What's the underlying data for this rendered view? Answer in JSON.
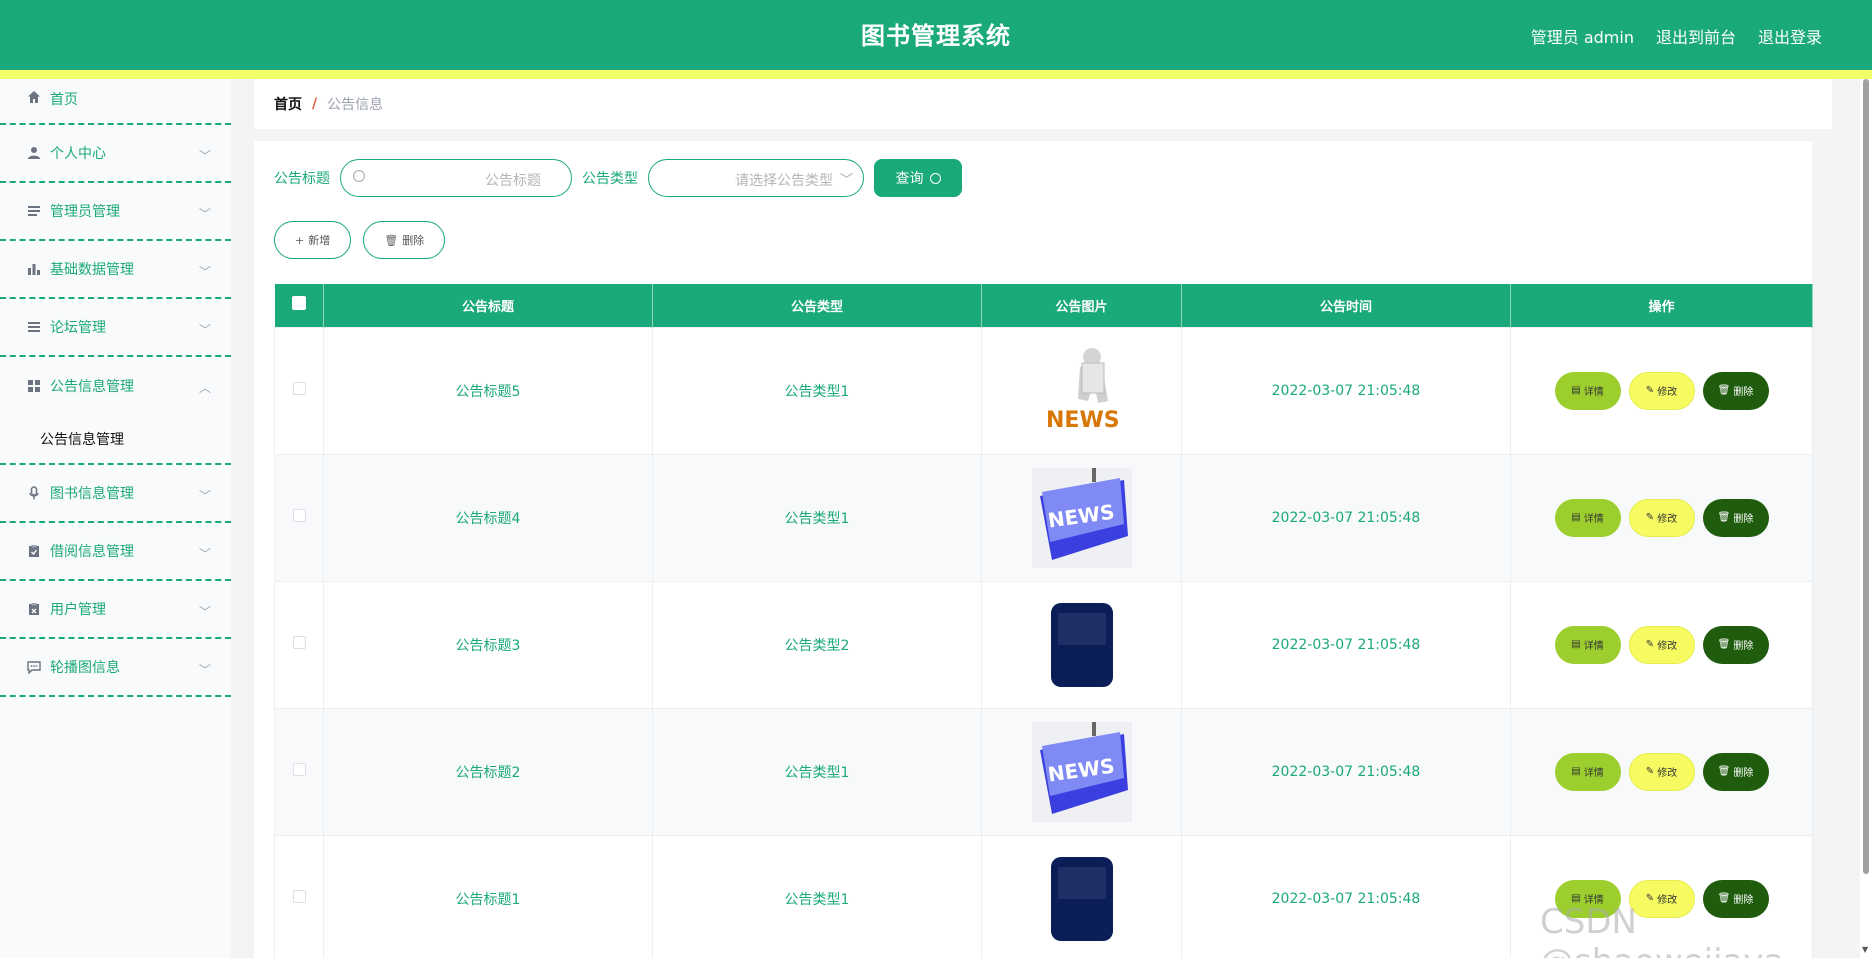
{
  "header": {
    "title": "图书管理系统",
    "admin_label": "管理员 admin",
    "to_front_label": "退出到前台",
    "logout_label": "退出登录"
  },
  "sidebar": {
    "items": [
      {
        "label": "首页",
        "icon": "home-icon"
      },
      {
        "label": "个人中心",
        "icon": "user-icon"
      },
      {
        "label": "管理员管理",
        "icon": "list-icon"
      },
      {
        "label": "基础数据管理",
        "icon": "bar-chart-icon"
      },
      {
        "label": "论坛管理",
        "icon": "menu-icon"
      },
      {
        "label": "公告信息管理",
        "icon": "grid-icon",
        "expanded": true,
        "sub": [
          "公告信息管理"
        ]
      },
      {
        "label": "图书信息管理",
        "icon": "microphone-icon"
      },
      {
        "label": "借阅信息管理",
        "icon": "clipboard-check-icon"
      },
      {
        "label": "用户管理",
        "icon": "clipboard-icon"
      },
      {
        "label": "轮播图信息",
        "icon": "chat-icon"
      }
    ]
  },
  "breadcrumb": {
    "home": "首页",
    "separator": "/",
    "current": "公告信息"
  },
  "search": {
    "title_label": "公告标题",
    "title_placeholder": "公告标题",
    "type_label": "公告类型",
    "type_placeholder": "请选择公告类型",
    "query_label": "查询"
  },
  "actions": {
    "add_label": "新增",
    "delete_label": "删除"
  },
  "table": {
    "columns": [
      "公告标题",
      "公告类型",
      "公告图片",
      "公告时间",
      "操作"
    ],
    "rows": [
      {
        "title": "公告标题5",
        "type": "公告类型1",
        "image": "news-3d-figure",
        "time": "2022-03-07 21:05:48"
      },
      {
        "title": "公告标题4",
        "type": "公告类型1",
        "image": "news-key",
        "time": "2022-03-07 21:05:48"
      },
      {
        "title": "公告标题3",
        "type": "公告类型2",
        "image": "cctv-news-logo",
        "time": "2022-03-07 21:05:48"
      },
      {
        "title": "公告标题2",
        "type": "公告类型1",
        "image": "news-key",
        "time": "2022-03-07 21:05:48"
      },
      {
        "title": "公告标题1",
        "type": "公告类型1",
        "image": "cctv-news-logo",
        "time": "2022-03-07 21:05:48"
      }
    ],
    "row_actions": {
      "detail": "详情",
      "edit": "修改",
      "delete": "删除"
    }
  },
  "watermark": "CSDN @shaoweijava",
  "colors": {
    "primary": "#1aa97a",
    "accent_yellow": "#f2ff68",
    "detail_btn": "#9ccf2e",
    "edit_btn": "#f6fb62",
    "delete_btn": "#1f5c0d"
  }
}
